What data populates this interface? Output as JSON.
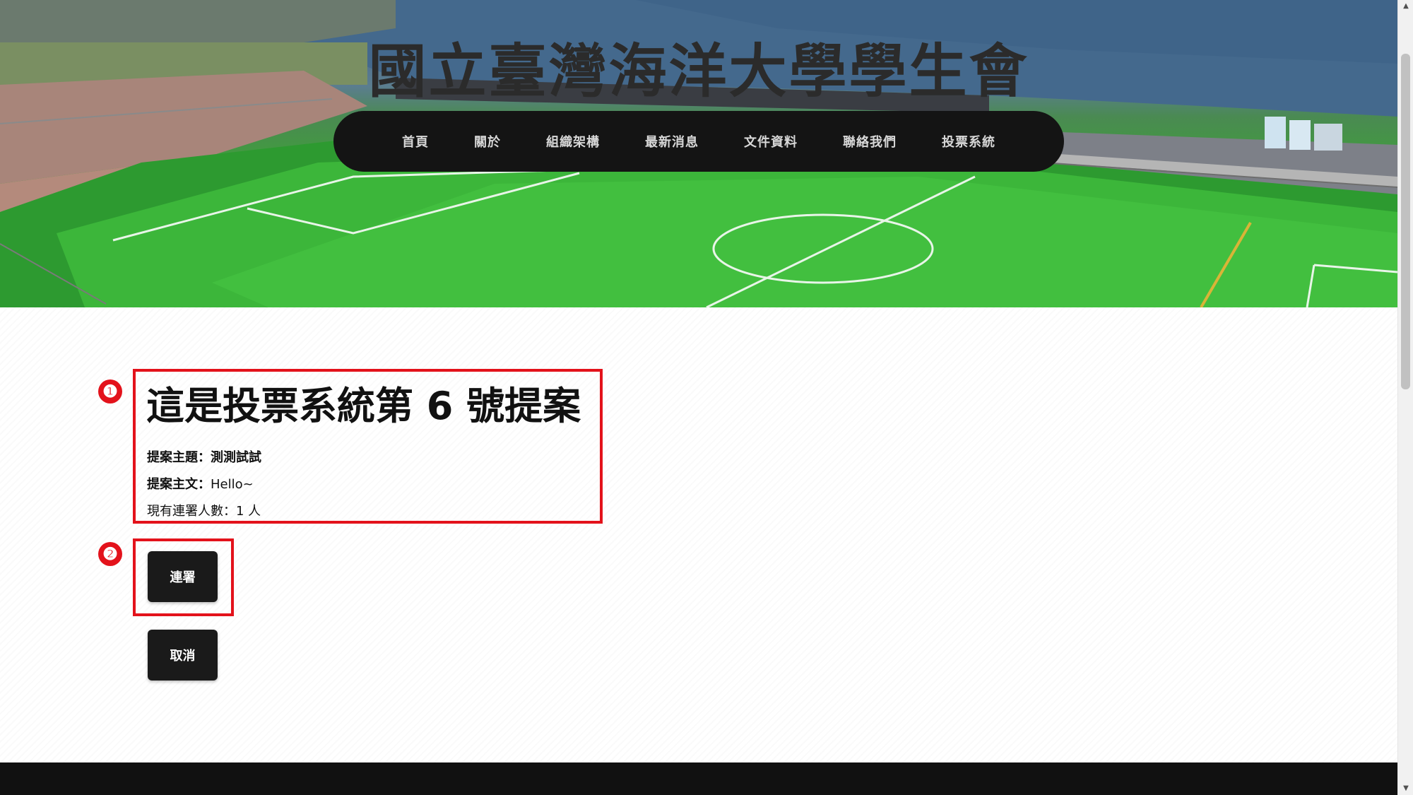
{
  "site": {
    "title": "國立臺灣海洋大學學生會"
  },
  "nav": {
    "items": [
      {
        "label": "首頁"
      },
      {
        "label": "關於"
      },
      {
        "label": "組織架構"
      },
      {
        "label": "最新消息"
      },
      {
        "label": "文件資料"
      },
      {
        "label": "聯絡我們"
      },
      {
        "label": "投票系統"
      }
    ]
  },
  "proposal": {
    "title": "這是投票系統第 6 號提案",
    "topic_label": "提案主題：",
    "topic_value": "測測試試",
    "body_label": "提案主文：",
    "body_value": "Hello~",
    "count_label": "現有連署人數：",
    "count_value": "1 人"
  },
  "actions": {
    "sign_label": "連署",
    "cancel_label": "取消"
  },
  "annotations": {
    "marker_1": "❶",
    "marker_2": "❷"
  },
  "colors": {
    "annotation_red": "#e3121b",
    "nav_bg": "#141414",
    "button_bg": "#1a1a1a"
  },
  "icons": {
    "scroll_up": "scroll-up-arrow-icon",
    "scroll_down": "scroll-down-arrow-icon"
  }
}
